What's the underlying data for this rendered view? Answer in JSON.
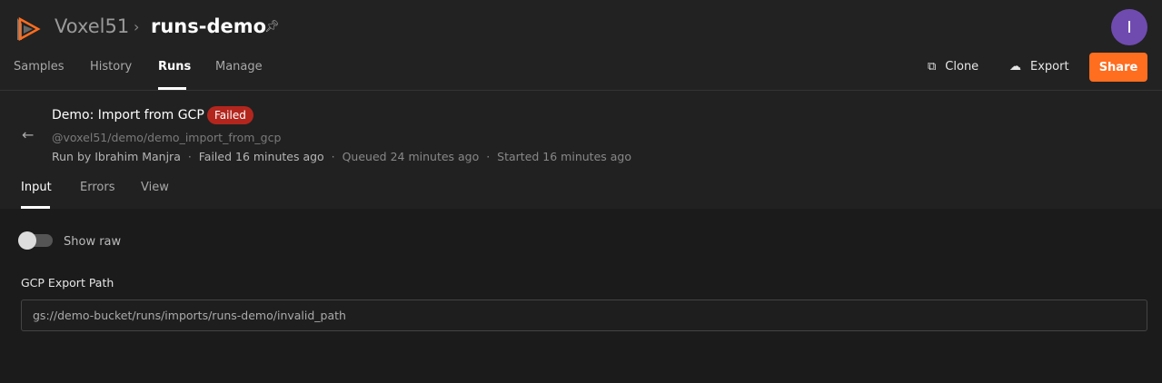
{
  "header": {
    "brand": "Voxel51",
    "dataset": "runs-demo",
    "avatar_initial": "I",
    "accent": "#ff6d1f"
  },
  "nav": {
    "items": [
      {
        "label": "Samples"
      },
      {
        "label": "History"
      },
      {
        "label": "Runs",
        "active": true
      },
      {
        "label": "Manage"
      }
    ]
  },
  "actions": {
    "clone": "Clone",
    "export": "Export",
    "share": "Share"
  },
  "run": {
    "title": "Demo: Import from GCP",
    "status": "Failed",
    "status_color": "#b3261e",
    "operator_path": "@voxel51/demo/demo_import_from_gcp",
    "run_by": "Run by Ibrahim Manjra",
    "failed": "Failed 16 minutes ago",
    "queued": "Queued 24 minutes ago",
    "started": "Started 16 minutes ago"
  },
  "tabs": [
    {
      "label": "Input",
      "active": true
    },
    {
      "label": "Errors"
    },
    {
      "label": "View"
    }
  ],
  "input": {
    "show_raw_label": "Show raw",
    "show_raw": false,
    "field_label": "GCP Export Path",
    "field_value": "gs://demo-bucket/runs/imports/runs-demo/invalid_path"
  }
}
